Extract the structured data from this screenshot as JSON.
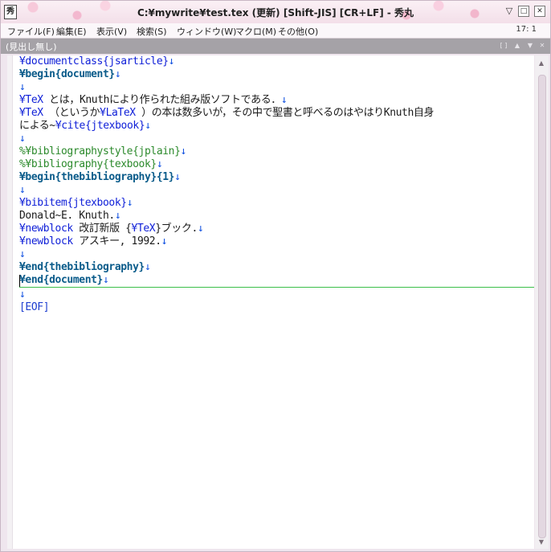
{
  "window": {
    "title": "C:¥mywrite¥test.tex (更新) [Shift-JIS] [CR+LF] - 秀丸",
    "app_icon_glyph": "秀",
    "minimize_glyph": "▽",
    "maximize_glyph": "□",
    "close_glyph": "✕"
  },
  "menubar": {
    "items": [
      "ファイル(F)",
      "編集(E)",
      "表示(V)",
      "検索(S)",
      "ウィンドウ(W)",
      "マクロ(M)",
      "その他(O)"
    ],
    "cursor_pos": "17: 1"
  },
  "headerbar": {
    "label": "(見出し無し)",
    "btn1": "[ ]",
    "btn2": "▲",
    "btn3": "▼",
    "btn4": "✕"
  },
  "editor": {
    "lf": "↓",
    "l1": "¥documentclass{jsarticle}",
    "l2": "¥begin{document}",
    "l4a": "¥TeX",
    "l4b": " とは，Knuthにより作られた組み版ソフトである．",
    "l5a": "¥TeX",
    "l5b": " （というか",
    "l5c": "¥LaTeX",
    "l5d": " ）の本は数多いが，その中で聖書と呼べるのはやはりKnuth自身",
    "l6a": "による~",
    "l6b": "¥cite{jtexbook}",
    "l8": "%¥bibliographystyle{jplain}",
    "l9": "%¥bibliography{texbook}",
    "l10": "¥begin{thebibliography}{1}",
    "l12": "¥bibitem{jtexbook}",
    "l13": "Donald~E. Knuth.",
    "l14a": "¥newblock",
    "l14b": " 改訂新版 {",
    "l14c": "¥TeX",
    "l14d": "}ブック.",
    "l15a": "¥newblock",
    "l15b": " アスキー, 1992.",
    "l17": "¥end{thebibliography}",
    "l18": "¥end{document}",
    "eof": "[EOF]"
  },
  "scrollbar": {
    "up_glyph": "▲",
    "down_glyph": "▼"
  }
}
